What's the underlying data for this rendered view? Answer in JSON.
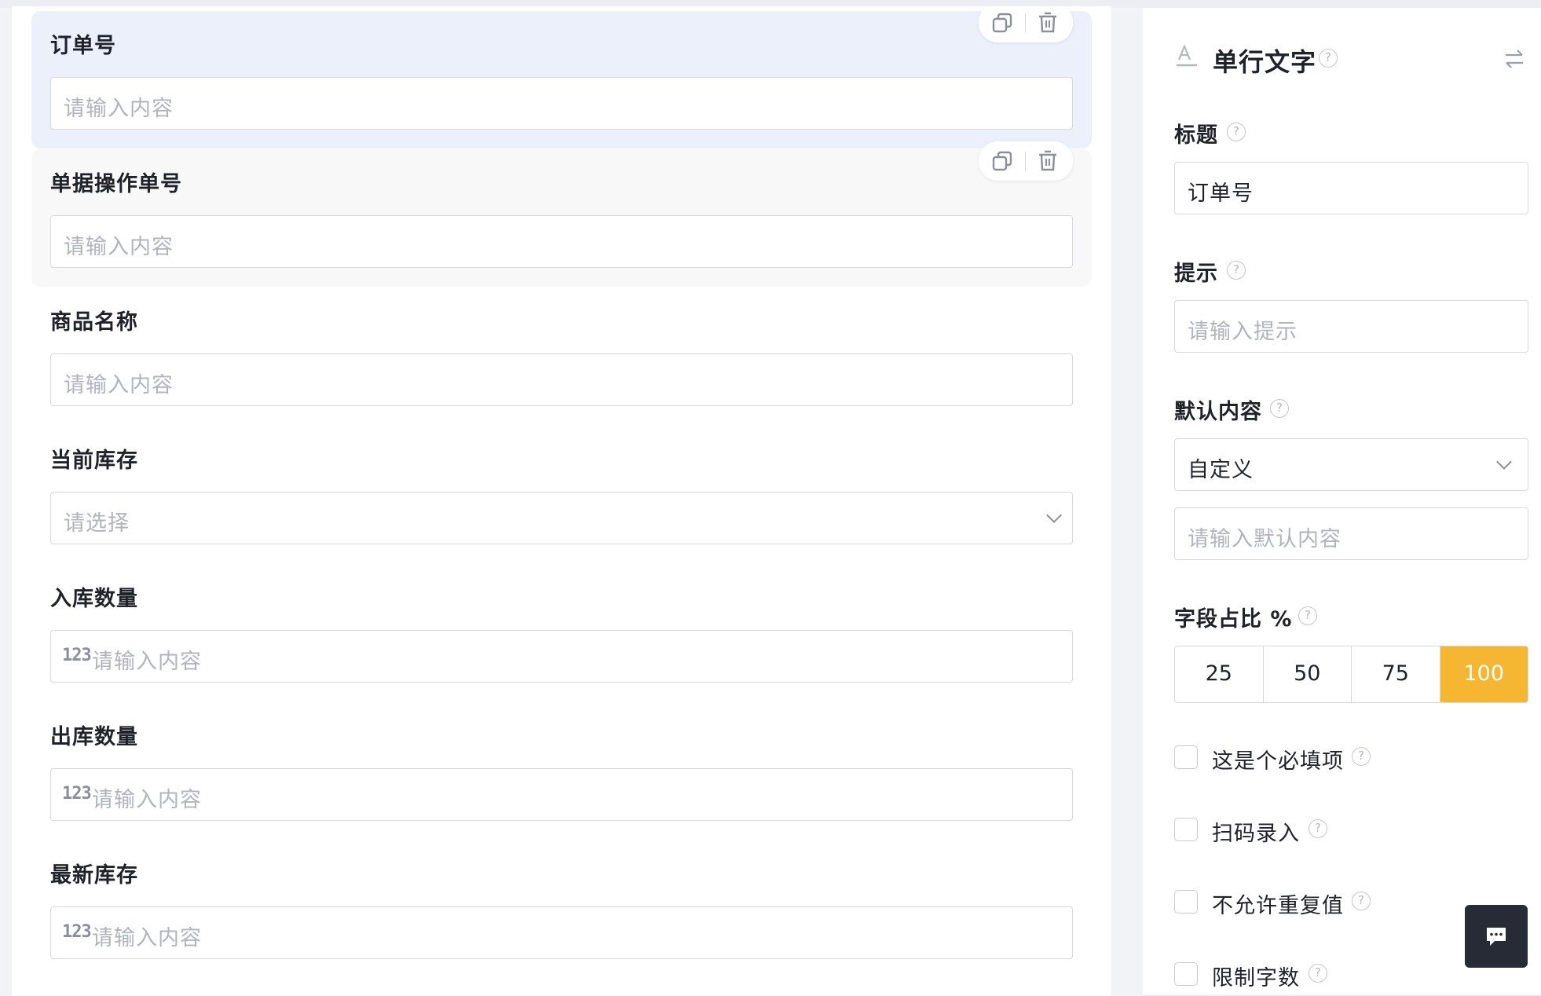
{
  "form": {
    "fields": [
      {
        "label": "订单号",
        "placeholder": "请输入内容",
        "kind": "text",
        "state": "selected"
      },
      {
        "label": "单据操作单号",
        "placeholder": "请输入内容",
        "kind": "text",
        "state": "hovered"
      },
      {
        "label": "商品名称",
        "placeholder": "请输入内容",
        "kind": "text",
        "state": "normal"
      },
      {
        "label": "当前库存",
        "placeholder": "请选择",
        "kind": "select",
        "state": "normal"
      },
      {
        "label": "入库数量",
        "placeholder": "请输入内容",
        "kind": "number",
        "state": "normal"
      },
      {
        "label": "出库数量",
        "placeholder": "请输入内容",
        "kind": "number",
        "state": "normal"
      },
      {
        "label": "最新库存",
        "placeholder": "请输入内容",
        "kind": "number",
        "state": "normal"
      }
    ],
    "number_icon_text": "123"
  },
  "panel": {
    "title": "单行文字",
    "title_icon": "text-field-icon",
    "help_glyph": "?",
    "title_section": {
      "label": "标题",
      "value": "订单号"
    },
    "hint_section": {
      "label": "提示",
      "placeholder": "请输入提示"
    },
    "default_section": {
      "label": "默认内容",
      "select_value": "自定义",
      "placeholder": "请输入默认内容"
    },
    "width_section": {
      "label": "字段占比 %",
      "options": [
        "25",
        "50",
        "75",
        "100"
      ],
      "selected": "100"
    },
    "checkboxes": [
      {
        "label": "这是个必填项",
        "checked": false
      },
      {
        "label": "扫码录入",
        "checked": false
      },
      {
        "label": "不允许重复值",
        "checked": false
      },
      {
        "label": "限制字数",
        "checked": false
      }
    ]
  },
  "colors": {
    "accent": "#f5b731",
    "selected_bg": "#ebf0fb",
    "chat_bg": "#262b36"
  }
}
